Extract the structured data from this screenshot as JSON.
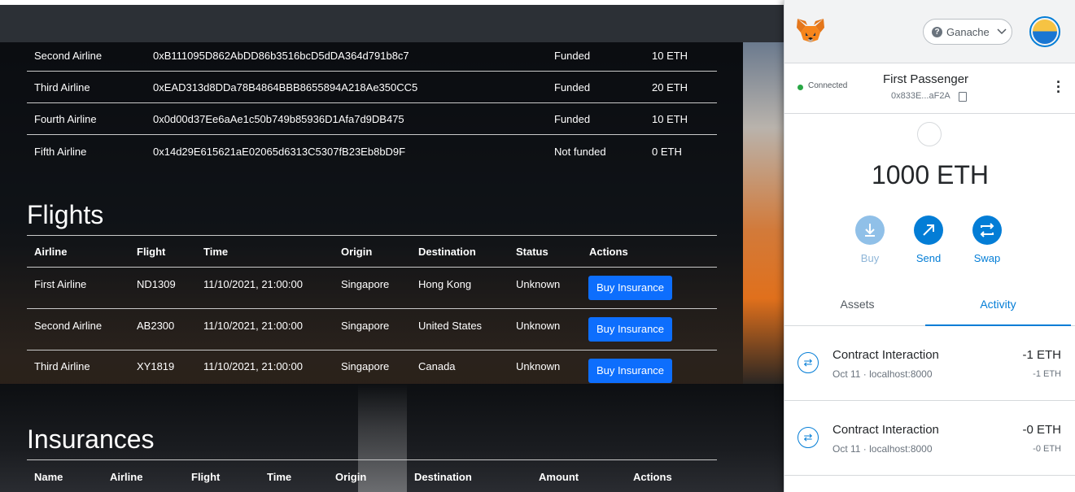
{
  "airlines": [
    {
      "name": "Second Airline",
      "address": "0xB111095D862AbDD86b3516bcD5dDA364d791b8c7",
      "status": "Funded",
      "fund": "10 ETH"
    },
    {
      "name": "Third Airline",
      "address": "0xEAD313d8DDa78B4864BBB8655894A218Ae350CC5",
      "status": "Funded",
      "fund": "20 ETH"
    },
    {
      "name": "Fourth Airline",
      "address": "0x0d00d37Ee6aAe1c50b749b85936D1Afa7d9DB475",
      "status": "Funded",
      "fund": "10 ETH"
    },
    {
      "name": "Fifth Airline",
      "address": "0x14d29E615621aE02065d6313C5307fB23Eb8bD9F",
      "status": "Not funded",
      "fund": "0 ETH"
    }
  ],
  "flights": {
    "title": "Flights",
    "headers": [
      "Airline",
      "Flight",
      "Time",
      "Origin",
      "Destination",
      "Status",
      "Actions"
    ],
    "rows": [
      {
        "airline": "First Airline",
        "flight": "ND1309",
        "time": "11/10/2021, 21:00:00",
        "origin": "Singapore",
        "destination": "Hong Kong",
        "status": "Unknown",
        "action": "Buy Insurance"
      },
      {
        "airline": "Second Airline",
        "flight": "AB2300",
        "time": "11/10/2021, 21:00:00",
        "origin": "Singapore",
        "destination": "United States",
        "status": "Unknown",
        "action": "Buy Insurance"
      },
      {
        "airline": "Third Airline",
        "flight": "XY1819",
        "time": "11/10/2021, 21:00:00",
        "origin": "Singapore",
        "destination": "Canada",
        "status": "Unknown",
        "action": "Buy Insurance"
      }
    ]
  },
  "insurances": {
    "title": "Insurances",
    "headers": [
      "Name",
      "Airline",
      "Flight",
      "Time",
      "Origin",
      "Destination",
      "Amount",
      "Actions"
    ]
  },
  "metamask": {
    "network": "Ganache",
    "network_icon": "question-icon",
    "connected": "Connected",
    "account_name": "First Passenger",
    "account_address": "0x833E...aF2A",
    "balance": "1000 ETH",
    "actions": [
      {
        "label": "Buy",
        "icon": "download-icon",
        "disabled": true
      },
      {
        "label": "Send",
        "icon": "arrow-up-right-icon",
        "disabled": false
      },
      {
        "label": "Swap",
        "icon": "swap-icon",
        "disabled": false
      }
    ],
    "tabs": [
      {
        "label": "Assets",
        "active": false
      },
      {
        "label": "Activity",
        "active": true
      }
    ],
    "transactions": [
      {
        "title": "Contract Interaction",
        "date": "Oct 11",
        "origin": "localhost:8000",
        "amount": "-1 ETH",
        "amount_secondary": "-1 ETH"
      },
      {
        "title": "Contract Interaction",
        "date": "Oct 11",
        "origin": "localhost:8000",
        "amount": "-0 ETH",
        "amount_secondary": "-0 ETH"
      }
    ],
    "colors": {
      "accent": "#037dd6",
      "connected": "#28a745"
    }
  },
  "colors": {
    "buy_button": "#0d6efd"
  }
}
